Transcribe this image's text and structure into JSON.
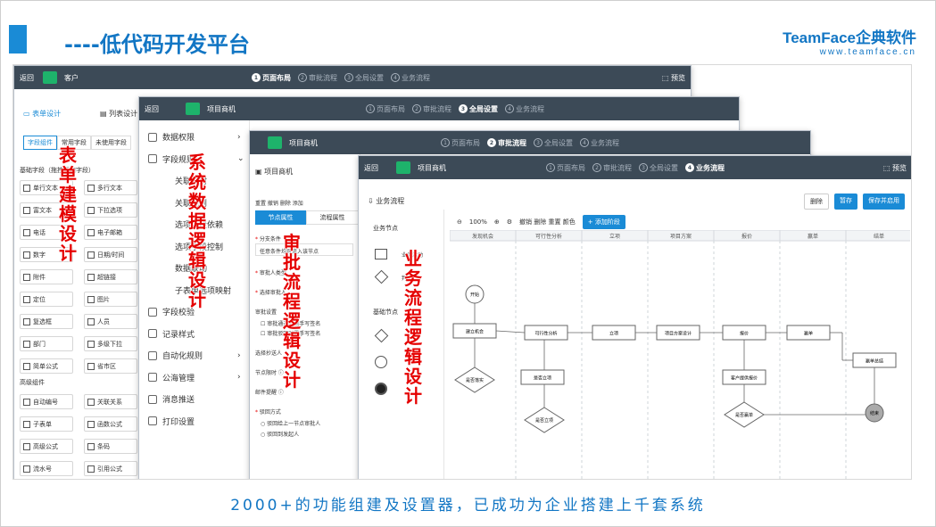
{
  "slide": {
    "title": "----低代码开发平台",
    "brand_name": "TeamFace企典软件",
    "brand_url": "www.teamface.cn",
    "caption": "2000+的功能组建及设置器，已成功为企业搭建上千套系统",
    "accent_color": "#1a8bd6",
    "text_color": "#1276c4",
    "highlight_color": "#e50000"
  },
  "w1": {
    "back": "返回",
    "app": "客户",
    "steps": [
      {
        "n": "1",
        "label": "页面布局",
        "active": true
      },
      {
        "n": "2",
        "label": "审批流程"
      },
      {
        "n": "3",
        "label": "全局设置"
      },
      {
        "n": "4",
        "label": "业务流程"
      }
    ],
    "preview": "预览",
    "tab_form": "表单设计",
    "tab_list": "列表设计",
    "subtabs": [
      "字段组件",
      "常用字段",
      "未使用字段"
    ],
    "basic_fields_title": "基础字段（拖拽添加字段）",
    "advanced_title": "高级组件",
    "fields": [
      [
        "单行文本",
        "多行文本"
      ],
      [
        "富文本",
        "下拉选项"
      ],
      [
        "电话",
        "电子邮箱"
      ],
      [
        "数字",
        "日期/时间"
      ],
      [
        "附件",
        "超链接"
      ],
      [
        "定位",
        "图片"
      ],
      [
        "复选框",
        "人员"
      ],
      [
        "部门",
        "多级下拉"
      ],
      [
        "简单公式",
        "省市区"
      ]
    ],
    "advanced": [
      [
        "自动编号",
        "关联关系"
      ],
      [
        "子表单",
        "函数公式"
      ],
      [
        "高级公式",
        "条码"
      ],
      [
        "流水号",
        "引用公式"
      ]
    ],
    "red_label": "表单建模设计"
  },
  "w2": {
    "back": "返回",
    "app": "项目商机",
    "steps": [
      {
        "n": "1",
        "label": "页面布局"
      },
      {
        "n": "2",
        "label": "审批流程"
      },
      {
        "n": "3",
        "label": "全局设置",
        "active": true
      },
      {
        "n": "4",
        "label": "业务流程"
      }
    ],
    "menu": [
      {
        "label": "数据权限",
        "arrow": "›"
      },
      {
        "label": "字段规则",
        "arrow": "⌄"
      },
      {
        "label": "关联映射",
        "sub": true
      },
      {
        "label": "关联规则",
        "sub": true
      },
      {
        "label": "选项字段依赖",
        "sub": true
      },
      {
        "label": "选项字段控制",
        "sub": true
      },
      {
        "label": "数据联动",
        "sub": true
      },
      {
        "label": "子表单选项映射",
        "sub": true
      },
      {
        "label": "字段校验",
        "arrow": ""
      },
      {
        "label": "记录样式",
        "arrow": ""
      },
      {
        "label": "自动化规则",
        "arrow": "›"
      },
      {
        "label": "公海管理",
        "arrow": "›"
      },
      {
        "label": "消息推送",
        "arrow": ""
      },
      {
        "label": "打印设置",
        "arrow": ""
      }
    ],
    "red_label": "系统数据逻辑设计"
  },
  "w3": {
    "app": "项目商机",
    "steps": [
      {
        "n": "1",
        "label": "页面布局"
      },
      {
        "n": "2",
        "label": "审批流程",
        "active": true
      },
      {
        "n": "3",
        "label": "全局设置"
      },
      {
        "n": "4",
        "label": "业务流程"
      }
    ],
    "panel_title": "项目商机",
    "toolbar": "重置  撤销  删除  添加",
    "tab_node": "节点属性",
    "tab_flow": "流程属性",
    "branch_cond": "分支条件",
    "branch_placeholder": "任意条件均可流入该节点",
    "approver_type": "审批人类型",
    "select_approver": "选择审批人",
    "approve_settings": "审批设置",
    "opt1": "审批通过时需手写签名",
    "opt2": "审批驳回时需手写签名",
    "select_cc": "选择抄送人",
    "node_time": "节点限时",
    "mail_remind": "邮件提醒",
    "reject_mode": "驳回方式",
    "reject1": "驳回给上一节点审批人",
    "reject2": "驳回到发起人",
    "red_label": "审批流程逻辑设计"
  },
  "w4": {
    "back": "返回",
    "app": "项目商机",
    "steps": [
      {
        "n": "1",
        "label": "页面布局"
      },
      {
        "n": "2",
        "label": "审批流程"
      },
      {
        "n": "3",
        "label": "全局设置"
      },
      {
        "n": "4",
        "label": "业务流程",
        "active": true
      }
    ],
    "preview": "预览",
    "section": "业务流程",
    "btn_delete": "删除",
    "btn_save": "暂存",
    "btn_save_enable": "保存并启用",
    "biz_nodes": "业务节点",
    "biz_activity": "业务活动",
    "judge": "判断",
    "basic_nodes": "基础节点",
    "zoom": "100%",
    "tools": "撤销  删除  重置  颜色",
    "add_stage": "+ 添加阶段",
    "lanes": [
      "发现机会",
      "可行性分析",
      "立项",
      "项目方案",
      "报价",
      "赢单",
      "结单"
    ],
    "nodes": {
      "start": "开始",
      "n1": "建立机会",
      "n2": "可行性分析",
      "n3": "立项",
      "n4": "项目方案设计",
      "n5": "报价",
      "n6": "赢单",
      "n7": "是否立项",
      "n8": "客户提供报价",
      "d1": "是否落实",
      "d2": "是否立项",
      "d3": "是否赢单",
      "n9": "赢单总结",
      "end": "结束"
    },
    "red_label": "业务流程逻辑设计"
  }
}
